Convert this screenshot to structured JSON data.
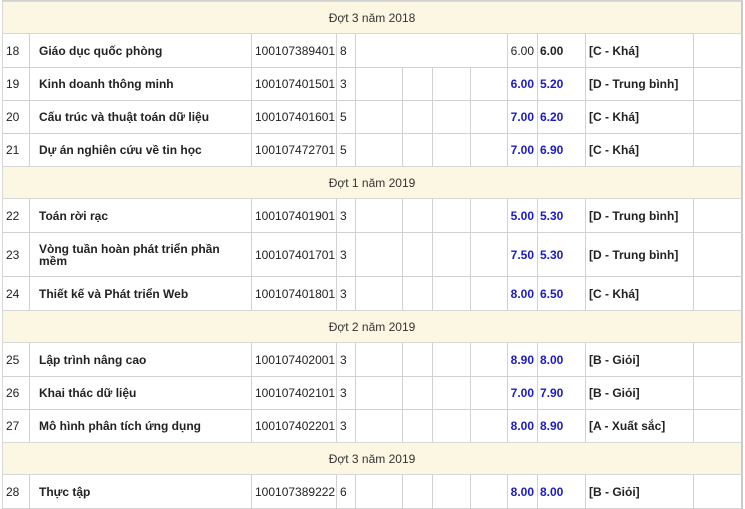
{
  "semesters": {
    "s3_2018": "Đợt 3 năm 2018",
    "s1_2019": "Đợt 1 năm 2019",
    "s2_2019": "Đợt 2 năm 2019",
    "s3_2019": "Đợt 3 năm 2019"
  },
  "courses": [
    {
      "stt": "18",
      "name": "Giáo dục quốc phòng",
      "code": "100107389401",
      "credits": "8",
      "score10": "6.00",
      "score_final": "6.00",
      "letter": "[C - Khá]"
    },
    {
      "stt": "19",
      "name": "Kinh doanh thông minh",
      "code": "100107401501",
      "credits": "3",
      "score10": "6.00",
      "score_final": "5.20",
      "letter": "[D - Trung bình]"
    },
    {
      "stt": "20",
      "name": "Cấu trúc và thuật toán dữ liệu",
      "code": "100107401601",
      "credits": "5",
      "score10": "7.00",
      "score_final": "6.20",
      "letter": "[C - Khá]"
    },
    {
      "stt": "21",
      "name": "Dự án nghiên cứu về tin học",
      "code": "100107472701",
      "credits": "5",
      "score10": "7.00",
      "score_final": "6.90",
      "letter": "[C - Khá]"
    },
    {
      "stt": "22",
      "name": "Toán rời rạc",
      "code": "100107401901",
      "credits": "3",
      "score10": "5.00",
      "score_final": "5.30",
      "letter": "[D - Trung bình]"
    },
    {
      "stt": "23",
      "name": "Vòng tuần hoàn phát triển phần mềm",
      "code": "100107401701",
      "credits": "3",
      "score10": "7.50",
      "score_final": "5.30",
      "letter": "[D - Trung bình]"
    },
    {
      "stt": "24",
      "name": "Thiết kế và Phát triển Web",
      "code": "100107401801",
      "credits": "3",
      "score10": "8.00",
      "score_final": "6.50",
      "letter": "[C - Khá]"
    },
    {
      "stt": "25",
      "name": "Lập trình nâng cao",
      "code": "100107402001",
      "credits": "3",
      "score10": "8.90",
      "score_final": "8.00",
      "letter": "[B - Giỏi]"
    },
    {
      "stt": "26",
      "name": "Khai thác dữ liệu",
      "code": "100107402101",
      "credits": "3",
      "score10": "7.00",
      "score_final": "7.90",
      "letter": "[B - Giỏi]"
    },
    {
      "stt": "27",
      "name": "Mô hình phân tích ứng dụng",
      "code": "100107402201",
      "credits": "3",
      "score10": "8.00",
      "score_final": "8.90",
      "letter": "[A - Xuất sắc]"
    },
    {
      "stt": "28",
      "name": "Thực tập",
      "code": "100107389222",
      "credits": "6",
      "score10": "8.00",
      "score_final": "8.00",
      "letter": "[B - Giỏi]"
    }
  ]
}
